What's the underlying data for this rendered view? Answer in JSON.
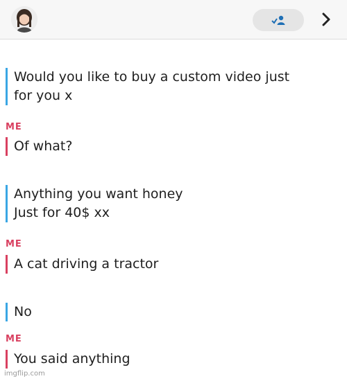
{
  "header": {
    "avatar_icon": "user-avatar-icon",
    "friend_icon": "add-friend-icon",
    "chevron_icon": "chevron-right-icon"
  },
  "colors": {
    "them_bar": "#3aa6e4",
    "me_bar": "#d94060",
    "me_label": "#d94060"
  },
  "messages": [
    {
      "sender": "them",
      "text": "Would you like to buy a custom video just\nfor you x"
    },
    {
      "sender_label": "ME",
      "text": "Of what?"
    },
    {
      "sender": "them",
      "text": "Anything you want honey\nJust for 40$ xx"
    },
    {
      "sender_label": "ME",
      "text": "A cat driving a tractor"
    },
    {
      "sender": "them",
      "text": "No"
    },
    {
      "sender_label": "ME",
      "text": "You said anything"
    }
  ],
  "watermark": "imgflip.com"
}
